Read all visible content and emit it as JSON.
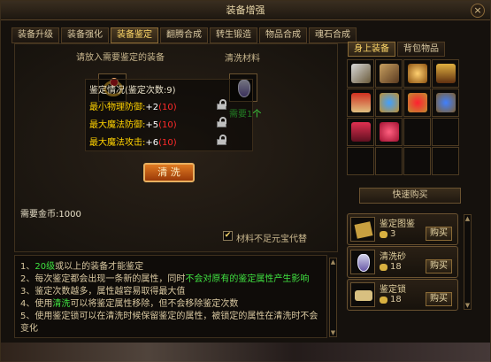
{
  "window": {
    "title": "装备增强",
    "close_label": "×"
  },
  "tabs": [
    {
      "label": "装备升级"
    },
    {
      "label": "装备强化"
    },
    {
      "label": "装备鉴定"
    },
    {
      "label": "翻腾合成"
    },
    {
      "label": "转生锻造"
    },
    {
      "label": "物品合成"
    },
    {
      "label": "魂石合成"
    }
  ],
  "active_tab": "装备鉴定",
  "identify": {
    "equip_prompt": "请放入需要鉴定的装备",
    "material_label": "清洗材料",
    "material_need": "需要1个",
    "info_title": "鉴定情况(鉴定次数:9)",
    "attrs": [
      {
        "name": "最小物理防御:",
        "value": "+2",
        "max": "(10)"
      },
      {
        "name": "最大魔法防御:",
        "value": "+5",
        "max": "(10)"
      },
      {
        "name": "最大魔法攻击:",
        "value": "+6",
        "max": "(10)"
      }
    ],
    "gold_label": "需要金币:1000",
    "wash_button": "清 洗",
    "auto_yuanbao_label": "材料不足元宝代替",
    "auto_yuanbao_checked": true
  },
  "right": {
    "tabs": [
      {
        "label": "身上装备"
      },
      {
        "label": "背包物品"
      }
    ],
    "active_tab": "身上装备",
    "grid_icons": [
      "sword-icon",
      "hammer-icon",
      "helmet-icon",
      "armor-icon",
      "book-icon",
      "bracelet-icon",
      "ring-icon",
      "belt-icon",
      "boots-icon",
      "gem-icon",
      "",
      "",
      "",
      "",
      "",
      ""
    ],
    "quick_buy_label": "快速购买",
    "shop": [
      {
        "name": "鉴定图鉴",
        "price": "3",
        "buy": "购买",
        "icon": "scroll-book-icon"
      },
      {
        "name": "清洗砂",
        "price": "18",
        "buy": "购买",
        "icon": "potion-icon"
      },
      {
        "name": "鉴定锁",
        "price": "18",
        "buy": "购买",
        "icon": "scroll-icon"
      }
    ]
  },
  "tips": [
    {
      "parts": [
        "1、",
        "20级",
        "或以上的装备才能鉴定"
      ]
    },
    {
      "parts": [
        "2、每次鉴定都会出现一条新的属性，同时",
        "不会对原有的鉴定属性产生影响"
      ]
    },
    {
      "parts": [
        "3、鉴定次数越多，属性越容易取得最大值"
      ]
    },
    {
      "parts": [
        "4、使用",
        "清洗",
        "可以将鉴定属性移除，但不会移除鉴定次数"
      ]
    },
    {
      "parts": [
        "5、使用鉴定锁可以在清洗时候保留鉴定的属性，被锁定的属性在清洗时不会"
      ]
    },
    {
      "parts": [
        "变化"
      ]
    }
  ],
  "colors": {
    "gold": "#ffd86a",
    "highlight_green": "#3fe040",
    "attr_name": "#ffd200",
    "attr_value": "#ffffff",
    "attr_max": "#ff2a2a"
  }
}
